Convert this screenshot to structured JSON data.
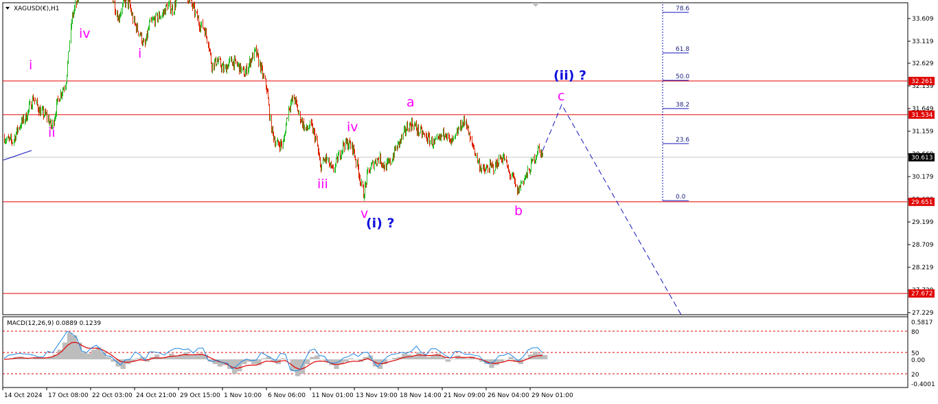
{
  "chart_data": {
    "type": "candlestick",
    "symbol": "XAGUSD(€),H1",
    "price_axis": {
      "ylim": [
        27.229,
        33.609
      ],
      "ticks": [
        33.609,
        33.119,
        32.629,
        32.139,
        31.649,
        31.159,
        30.669,
        30.179,
        29.689,
        29.199,
        28.709,
        28.219,
        27.729,
        27.229
      ]
    },
    "x_labels": [
      "14 Oct 2024",
      "17 Oct 08:00",
      "22 Oct 03:00",
      "24 Oct 21:00",
      "29 Oct 15:00",
      "1 Nov 10:00",
      "6 Nov 06:00",
      "11 Nov 01:00",
      "13 Nov 19:00",
      "18 Nov 14:00",
      "21 Nov 09:00",
      "26 Nov 04:00",
      "29 Nov 01:00"
    ],
    "price_path": [
      [
        0,
        31.2
      ],
      [
        8,
        31.0
      ],
      [
        18,
        30.95
      ],
      [
        28,
        31.3
      ],
      [
        38,
        31.5
      ],
      [
        48,
        31.9
      ],
      [
        58,
        31.6
      ],
      [
        68,
        31.5
      ],
      [
        75,
        31.25
      ],
      [
        85,
        31.9
      ],
      [
        95,
        32.2
      ],
      [
        100,
        32.9
      ],
      [
        104,
        33.6
      ],
      [
        110,
        33.9
      ],
      [
        120,
        34.4
      ],
      [
        130,
        34.6
      ],
      [
        140,
        34.7
      ],
      [
        155,
        34.3
      ],
      [
        165,
        34.0
      ],
      [
        172,
        33.6
      ],
      [
        180,
        34.0
      ],
      [
        188,
        33.9
      ],
      [
        195,
        33.5
      ],
      [
        203,
        33.3
      ],
      [
        210,
        33.0
      ],
      [
        218,
        33.5
      ],
      [
        226,
        33.6
      ],
      [
        236,
        33.7
      ],
      [
        244,
        33.9
      ],
      [
        252,
        33.8
      ],
      [
        262,
        34.3
      ],
      [
        272,
        34.1
      ],
      [
        282,
        33.8
      ],
      [
        290,
        33.5
      ],
      [
        297,
        33.4
      ],
      [
        303,
        33.1
      ],
      [
        308,
        32.6
      ],
      [
        316,
        32.7
      ],
      [
        326,
        32.5
      ],
      [
        336,
        32.7
      ],
      [
        346,
        32.6
      ],
      [
        356,
        32.4
      ],
      [
        364,
        32.7
      ],
      [
        372,
        32.9
      ],
      [
        380,
        32.5
      ],
      [
        388,
        32.1
      ],
      [
        395,
        31.2
      ],
      [
        402,
        30.9
      ],
      [
        412,
        30.9
      ],
      [
        420,
        31.7
      ],
      [
        428,
        31.9
      ],
      [
        436,
        31.5
      ],
      [
        445,
        31.2
      ],
      [
        452,
        31.3
      ],
      [
        460,
        31.0
      ],
      [
        466,
        30.4
      ],
      [
        474,
        30.6
      ],
      [
        484,
        30.3
      ],
      [
        492,
        30.6
      ],
      [
        500,
        30.9
      ],
      [
        508,
        30.9
      ],
      [
        514,
        30.8
      ],
      [
        522,
        30.3
      ],
      [
        529,
        29.8
      ],
      [
        536,
        30.3
      ],
      [
        544,
        30.5
      ],
      [
        552,
        30.6
      ],
      [
        560,
        30.4
      ],
      [
        568,
        30.5
      ],
      [
        576,
        30.8
      ],
      [
        584,
        31.0
      ],
      [
        592,
        31.25
      ],
      [
        600,
        31.35
      ],
      [
        608,
        31.2
      ],
      [
        616,
        31.1
      ],
      [
        624,
        31.0
      ],
      [
        632,
        30.9
      ],
      [
        640,
        31.0
      ],
      [
        648,
        31.2
      ],
      [
        655,
        30.9
      ],
      [
        662,
        31.0
      ],
      [
        670,
        31.3
      ],
      [
        678,
        31.4
      ],
      [
        684,
        31.0
      ],
      [
        690,
        30.8
      ],
      [
        696,
        30.5
      ],
      [
        704,
        30.3
      ],
      [
        712,
        30.4
      ],
      [
        720,
        30.4
      ],
      [
        728,
        30.6
      ],
      [
        734,
        30.6
      ],
      [
        740,
        30.3
      ],
      [
        747,
        30.15
      ],
      [
        753,
        29.85
      ],
      [
        760,
        30.1
      ],
      [
        768,
        30.25
      ],
      [
        776,
        30.55
      ],
      [
        784,
        30.8
      ],
      [
        790,
        30.65
      ]
    ],
    "candles_approx": 690,
    "horizontal_levels": [
      32.261,
      31.534,
      30.613,
      29.651,
      27.672
    ],
    "current_price": 30.613,
    "fibonacci": {
      "levels": [
        "0.0",
        "23.6",
        "38.2",
        "50.0",
        "61.8",
        "78.6"
      ],
      "values": [
        0,
        23.6,
        38.2,
        50.0,
        61.8,
        78.6
      ]
    },
    "projection": [
      [
        790,
        30.75
      ],
      [
        818,
        31.75
      ],
      [
        992,
        27.21
      ]
    ],
    "projection_style": "dashed",
    "labels": [
      "i",
      "ii",
      "iv",
      "i",
      "iii",
      "iv",
      "v",
      "a",
      "b",
      "c",
      "(i) ?",
      "(ii) ?"
    ],
    "indicator": {
      "name": "MACD(12,26,9) 0.0889 0.1239",
      "ticks": [
        "0.5817",
        "80",
        "50",
        "0.00",
        "20",
        "-0.4001"
      ]
    },
    "indicator_series": [
      0,
      0.02,
      0.05,
      0.06,
      0.02,
      0.01,
      0.05,
      0.03,
      0.02,
      0.05,
      0.1,
      0.2,
      0.35,
      0.55,
      0.5,
      0.35,
      0.15,
      0.12,
      0.2,
      0.25,
      0.15,
      0.05,
      -0.05,
      -0.15,
      -0.2,
      -0.1,
      -0.05,
      0.02,
      0.05,
      -0.05,
      0.05,
      0.1,
      0.02,
      0.05,
      0.12,
      0.08,
      0.1,
      0.15,
      0.08,
      0.1,
      0.12,
      0.1,
      -0.05,
      -0.1,
      -0.15,
      -0.12,
      -0.2,
      -0.3,
      -0.25,
      -0.1,
      -0.05,
      -0.1,
      -0.12,
      0.02,
      0.06,
      -0.05,
      -0.1,
      0.02,
      0,
      -0.25,
      -0.35,
      -0.3,
      -0.1,
      0.05,
      0.08,
      0.0,
      -0.05,
      -0.12,
      -0.2,
      -0.1,
      -0.05,
      0.02,
      0.0,
      -0.05,
      0.05,
      0.08,
      -0.15,
      -0.2,
      -0.1,
      0.0,
      0.03,
      0.05,
      0.12,
      0.1,
      0.08,
      0.15,
      0.1,
      0.05,
      0.08,
      0.12,
      0.05,
      -0.05,
      0.0,
      0.08,
      0.05,
      0.02,
      0.06,
      0.0,
      -0.05,
      -0.1,
      -0.18,
      -0.12,
      -0.05,
      0.0,
      0.05,
      -0.05,
      -0.1,
      0.02,
      0.1,
      0.16,
      0.12,
      0.09
    ],
    "colors": {
      "bull": "#22bb22",
      "bear": "#dd2200",
      "level": "#e00000",
      "projection": "#1010bb",
      "label": "#ff00ff",
      "label_alt": "#1010dd",
      "tag_bg": "#e00000",
      "current_bg": "#000000",
      "signal": "#e00000",
      "macd_line": "#1e88e5",
      "histogram": "#bdbdbd"
    }
  }
}
